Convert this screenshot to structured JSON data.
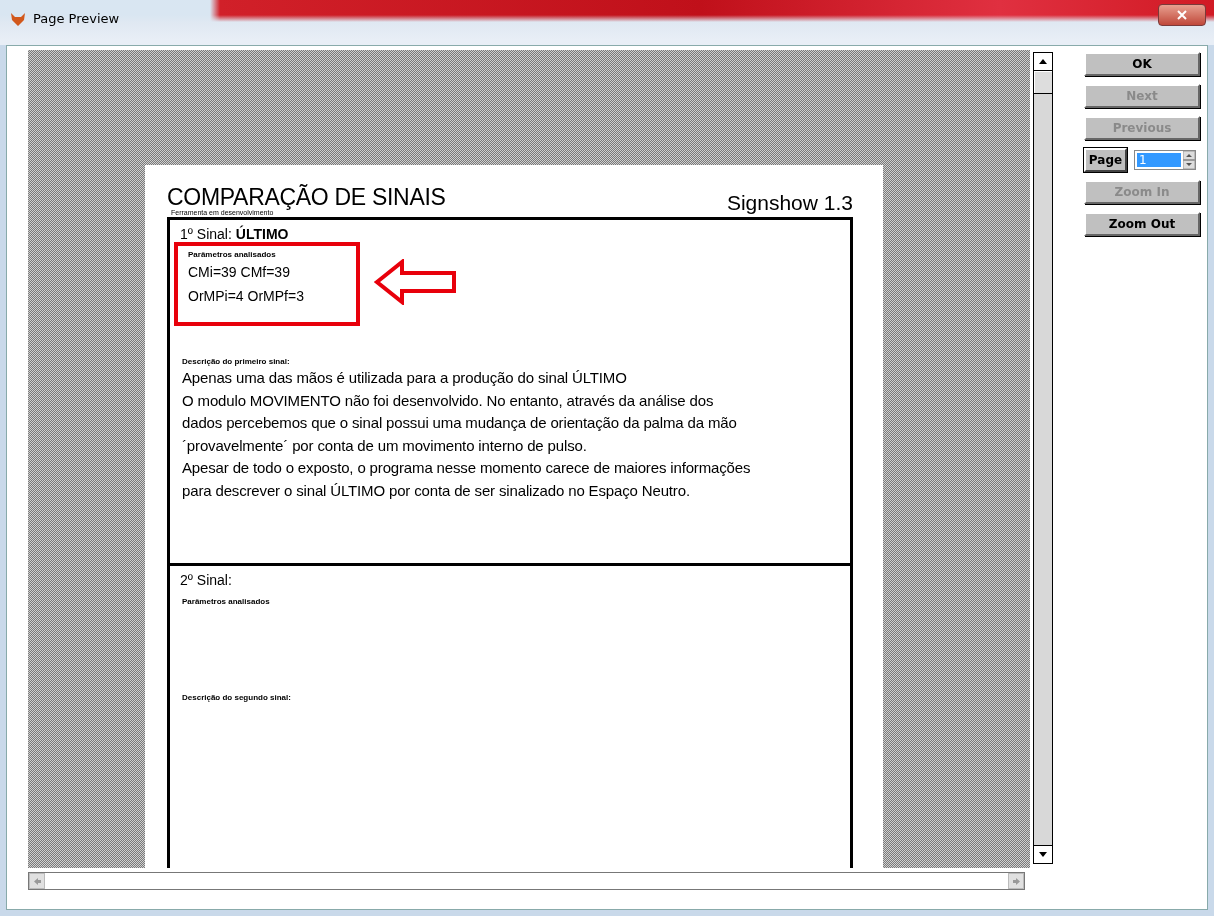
{
  "window": {
    "title": "Page Preview"
  },
  "document": {
    "title": "COMPARAÇÃO DE SINAIS",
    "subtitle": "Ferramenta em desenvolvimento",
    "app_name": "Signshow 1.3",
    "sections": [
      {
        "label": "1º Sinal:",
        "value": "ÚLTIMO",
        "highlighted": true,
        "params_label": "Parâmetros analisados",
        "params": [
          "CMi=39 CMf=39",
          "OrMPi=4 OrMPf=3"
        ],
        "description_label": "Descrição do primeiro sinal:",
        "description": [
          "Apenas uma das mãos é utilizada para a produção do sinal ÚLTIMO",
          "O modulo MOVIMENTO não foi desenvolvido. No entanto, através da análise dos",
          "dados percebemos que o sinal possui uma mudança de orientação da palma da mão",
          "´provavelmente´ por conta de um movimento interno de pulso.",
          "Apesar de todo o exposto, o programa nesse momento carece de maiores informações",
          "para descrever o sinal ÚLTIMO por conta de ser sinalizado no Espaço Neutro."
        ]
      },
      {
        "label": "2º Sinal:",
        "highlighted": false,
        "params_label": "Parâmetros analisados",
        "description_label": "Descrição do segundo sinal:"
      }
    ]
  },
  "controls": [
    {
      "kind": "button",
      "label": "OK",
      "disabled": false
    },
    {
      "kind": "button",
      "label": "Next",
      "disabled": true
    },
    {
      "kind": "button",
      "label": "Previous",
      "disabled": true
    },
    {
      "kind": "page",
      "label": "Page",
      "value": "1"
    },
    {
      "kind": "button",
      "label": "Zoom In",
      "disabled": true
    },
    {
      "kind": "button",
      "label": "Zoom Out",
      "disabled": false
    }
  ]
}
